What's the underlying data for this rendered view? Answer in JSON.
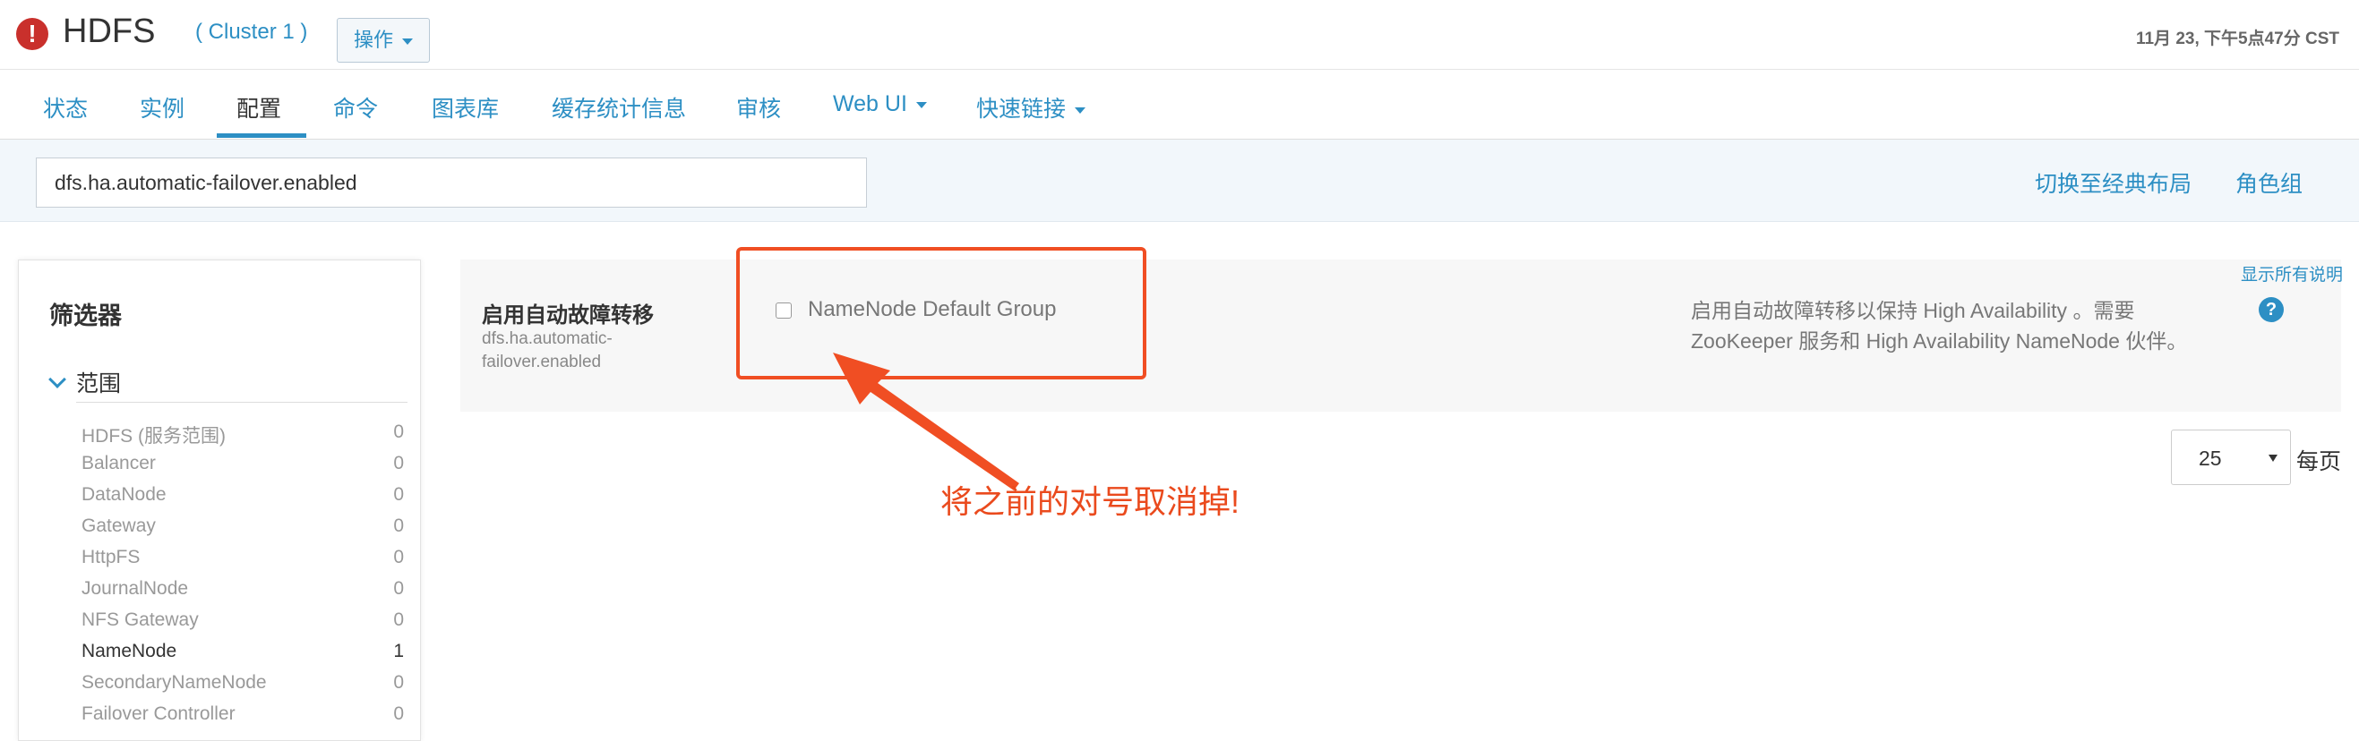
{
  "header": {
    "alert_icon": "!",
    "title": "HDFS",
    "cluster": "( Cluster 1 )",
    "ops_label": "操作",
    "timestamp": "11月 23, 下午5点47分 CST"
  },
  "tabs": [
    {
      "label": "状态"
    },
    {
      "label": "实例"
    },
    {
      "label": "配置",
      "active": true
    },
    {
      "label": "命令"
    },
    {
      "label": "图表库"
    },
    {
      "label": "缓存统计信息"
    },
    {
      "label": "审核"
    },
    {
      "label": "Web UI",
      "dropdown": true
    },
    {
      "label": "快速链接",
      "dropdown": true
    }
  ],
  "search": {
    "value": "dfs.ha.automatic-failover.enabled"
  },
  "toolbar": {
    "switch_layout": "切换至经典布局",
    "role_groups": "角色组"
  },
  "filter": {
    "title": "筛选器",
    "scope_label": "范围",
    "items": [
      {
        "label": "HDFS (服务范围)",
        "count": "0"
      },
      {
        "label": "Balancer",
        "count": "0"
      },
      {
        "label": "DataNode",
        "count": "0"
      },
      {
        "label": "Gateway",
        "count": "0"
      },
      {
        "label": "HttpFS",
        "count": "0"
      },
      {
        "label": "JournalNode",
        "count": "0"
      },
      {
        "label": "NFS Gateway",
        "count": "0"
      },
      {
        "label": "NameNode",
        "count": "1",
        "active": true
      },
      {
        "label": "SecondaryNameNode",
        "count": "0"
      },
      {
        "label": "Failover Controller",
        "count": "0"
      }
    ]
  },
  "config": {
    "display_name": "启用自动故障转移",
    "key": "dfs.ha.automatic-failover.enabled",
    "group_label": "NameNode Default Group",
    "checked": false,
    "description": "启用自动故障转移以保持 High Availability 。需要 ZooKeeper 服务和 High Availability NameNode 伙伴。"
  },
  "show_all_descriptions": "显示所有说明",
  "help_icon": "?",
  "annotation": {
    "text": "将之前的对号取消掉!",
    "color": "#ea4a1d"
  },
  "pagination": {
    "per_page_value": "25",
    "per_page_label": "每页"
  },
  "colors": {
    "accent": "#2d8fc4",
    "alert": "#c9302c",
    "annotation": "#f04e23"
  }
}
